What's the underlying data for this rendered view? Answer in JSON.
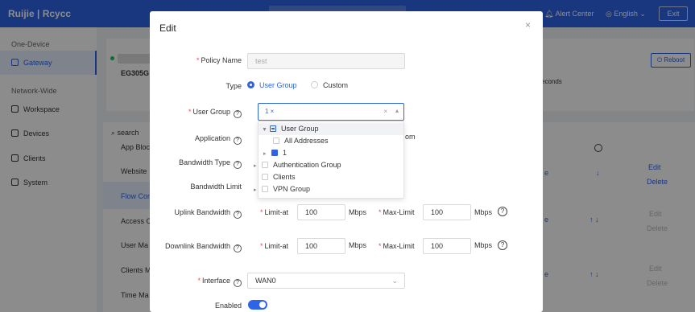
{
  "topbar": {
    "logo": "Ruijie | Rcycc",
    "alert_center": "Alert Center",
    "language": "English",
    "exit": "Exit"
  },
  "sidebar": {
    "group1": "One-Device",
    "gateway": "Gateway",
    "group2": "Network-Wide",
    "items": [
      {
        "label": "Workspace"
      },
      {
        "label": "Devices"
      },
      {
        "label": "Clients"
      },
      {
        "label": "System"
      }
    ]
  },
  "device": {
    "model": "EG305G",
    "status_color": "#27c24c",
    "seconds_text": "econds",
    "reboot": "Reboot"
  },
  "submenu": {
    "search": "search",
    "items": [
      "App Bloc",
      "Website",
      "Flow Con",
      "Access C",
      "User Ma",
      "Clients M",
      "Time Ma"
    ]
  },
  "table": {
    "edit": "Edit",
    "delete": "Delete",
    "link_e": "e"
  },
  "modal": {
    "title": "Edit",
    "close": "×",
    "policy_name_label": "Policy Name",
    "policy_name_placeholder": "test",
    "type_label": "Type",
    "type_options": [
      "User Group",
      "Custom"
    ],
    "type_selected": "User Group",
    "user_group_label": "User Group",
    "user_group_tag": "1 ×",
    "application_label": "Application",
    "application_partial": "om",
    "bandwidth_type_label": "Bandwidth Type",
    "bandwidth_limit_label": "Bandwidth Limit",
    "uplink_label": "Uplink Bandwidth",
    "downlink_label": "Downlink Bandwidth",
    "limit_at_label": "Limit-at",
    "max_limit_label": "Max-Limit",
    "uplink_limit_at": "100",
    "uplink_max_limit": "100",
    "downlink_limit_at": "100",
    "downlink_max_limit": "100",
    "unit": "Mbps",
    "interface_label": "Interface",
    "interface_value": "WAN0",
    "enabled_label": "Enabled",
    "enabled": true
  },
  "tree": [
    {
      "label": "User Group"
    },
    {
      "label": "All Addresses"
    },
    {
      "label": "1"
    },
    {
      "label": "Authentication Group"
    },
    {
      "label": "Clients"
    },
    {
      "label": "VPN Group"
    }
  ],
  "colors": {
    "accent": "#2e64e6",
    "required": "#e84b4b"
  }
}
